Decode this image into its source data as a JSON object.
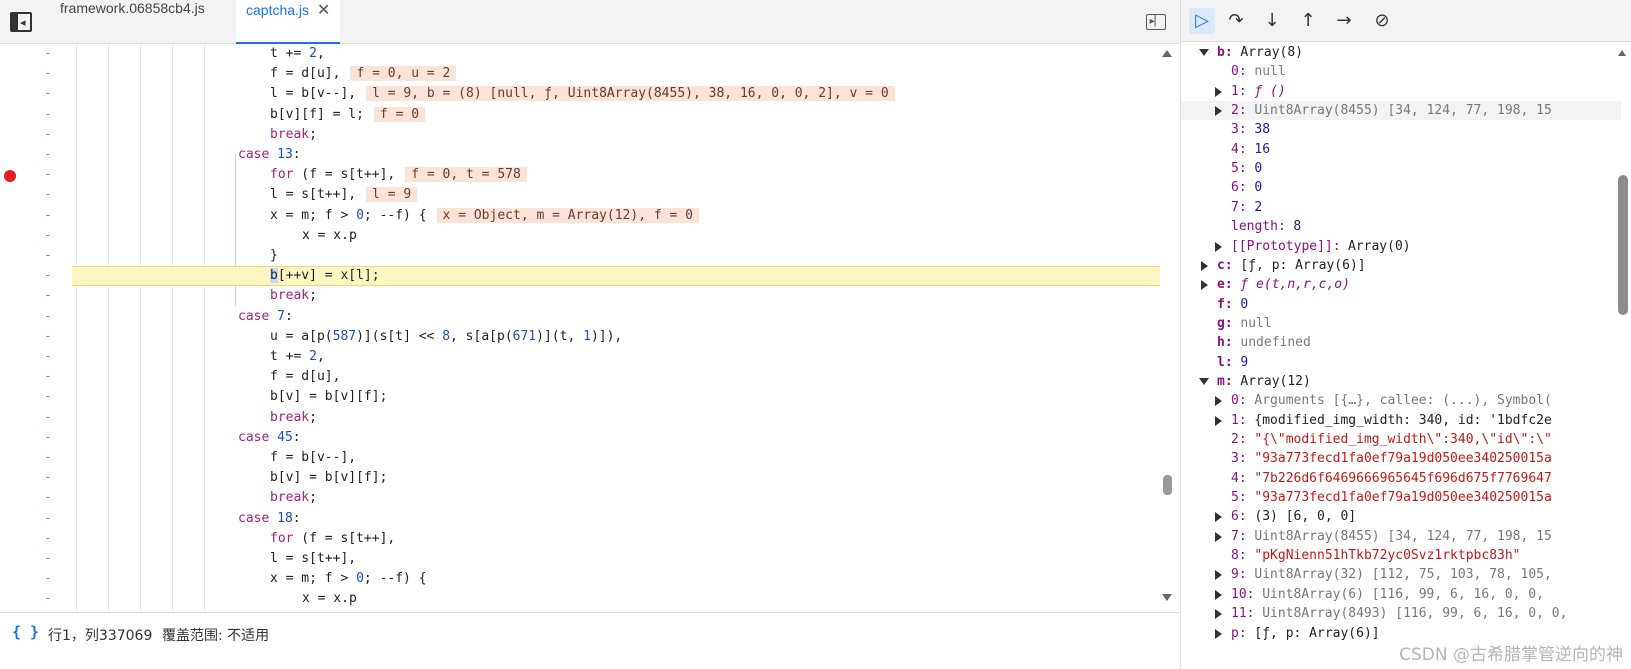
{
  "tabs": [
    {
      "label": "framework.06858cb4.js",
      "active": false
    },
    {
      "label": "captcha.js",
      "active": true
    }
  ],
  "code_lines": [
    {
      "text": "t += 2,",
      "indent": 2
    },
    {
      "text": "f = d[u],",
      "indent": 2,
      "inline": "f = 0, u = 2"
    },
    {
      "text": "l = b[v--],",
      "indent": 2,
      "inline": "l = 9, b = (8) [null, ƒ, Uint8Array(8455), 38, 16, 0, 0, 2], v = 0"
    },
    {
      "text": "b[v][f] = l;",
      "indent": 2,
      "inline": "f = 0"
    },
    {
      "text": "break;",
      "indent": 2,
      "kw": true
    },
    {
      "text": "case 13:",
      "indent": 1,
      "case": true
    },
    {
      "text": "for (f = s[t++],",
      "indent": 2,
      "inline": "f = 0, t = 578",
      "breakpoint": true
    },
    {
      "text": "l = s[t++],",
      "indent": 2,
      "inline": "l = 9"
    },
    {
      "text": "x = m; f > 0; --f) {",
      "indent": 2,
      "inline": "x = Object, m = Array(12), f = 0"
    },
    {
      "text": "x = x.p",
      "indent": 3
    },
    {
      "text": "}",
      "indent": 2
    },
    {
      "text": "b[++v] = x[l];",
      "indent": 2,
      "current": true
    },
    {
      "text": "break;",
      "indent": 2,
      "kw": true
    },
    {
      "text": "case 7:",
      "indent": 1,
      "case": true
    },
    {
      "text": "u = a[p(587)](s[t] << 8, s[a[p(671)](t, 1)]),",
      "indent": 2
    },
    {
      "text": "t += 2,",
      "indent": 2
    },
    {
      "text": "f = d[u],",
      "indent": 2
    },
    {
      "text": "b[v] = b[v][f];",
      "indent": 2
    },
    {
      "text": "break;",
      "indent": 2,
      "kw": true
    },
    {
      "text": "case 45:",
      "indent": 1,
      "case": true
    },
    {
      "text": "f = b[v--],",
      "indent": 2
    },
    {
      "text": "b[v] = b[v][f];",
      "indent": 2
    },
    {
      "text": "break;",
      "indent": 2,
      "kw": true
    },
    {
      "text": "case 18:",
      "indent": 1,
      "case": true
    },
    {
      "text": "for (f = s[t++],",
      "indent": 2
    },
    {
      "text": "l = s[t++],",
      "indent": 2
    },
    {
      "text": "x = m; f > 0; --f) {",
      "indent": 2
    },
    {
      "text": "x = x.p",
      "indent": 3
    }
  ],
  "gutter_marker": "-",
  "status": {
    "braces": "{ }",
    "position": "行1，列337069",
    "coverage": "覆盖范围: 不适用"
  },
  "debug_buttons": [
    "resume",
    "step-over",
    "step-into",
    "step-out",
    "step",
    "deactivate-breakpoints"
  ],
  "scope": [
    {
      "level": 0,
      "expand": "down",
      "key": "b",
      "value": "Array(8)",
      "vclass": "obj",
      "bold": true
    },
    {
      "level": 1,
      "key": "0",
      "value": "null",
      "vclass": "null"
    },
    {
      "level": 1,
      "expand": "right",
      "key": "1",
      "value": "ƒ ()",
      "vclass": "fn"
    },
    {
      "level": 1,
      "expand": "right",
      "key": "2",
      "value": "Uint8Array(8455) [34, 124, 77, 198, 15",
      "vclass": "dim",
      "hover": true
    },
    {
      "level": 1,
      "key": "3",
      "value": "38",
      "vclass": "num"
    },
    {
      "level": 1,
      "key": "4",
      "value": "16",
      "vclass": "num"
    },
    {
      "level": 1,
      "key": "5",
      "value": "0",
      "vclass": "num"
    },
    {
      "level": 1,
      "key": "6",
      "value": "0",
      "vclass": "num"
    },
    {
      "level": 1,
      "key": "7",
      "value": "2",
      "vclass": "num"
    },
    {
      "level": 1,
      "key": "length",
      "value": "8",
      "vclass": "num"
    },
    {
      "level": 1,
      "expand": "right",
      "key": "[[Prototype]]",
      "value": "Array(0)",
      "vclass": "obj"
    },
    {
      "level": 0,
      "expand": "right",
      "key": "c",
      "value": "[ƒ, p: Array(6)]",
      "vclass": "obj",
      "bold": true
    },
    {
      "level": 0,
      "expand": "right",
      "key": "e",
      "value": "ƒ e(t,n,r,c,o)",
      "vclass": "fn",
      "bold": true
    },
    {
      "level": 0,
      "key": "f",
      "value": "0",
      "vclass": "num",
      "bold": true
    },
    {
      "level": 0,
      "key": "g",
      "value": "null",
      "vclass": "null",
      "bold": true
    },
    {
      "level": 0,
      "key": "h",
      "value": "undefined",
      "vclass": "null",
      "bold": true
    },
    {
      "level": 0,
      "key": "l",
      "value": "9",
      "vclass": "num",
      "bold": true
    },
    {
      "level": 0,
      "expand": "down",
      "key": "m",
      "value": "Array(12)",
      "vclass": "obj",
      "bold": true
    },
    {
      "level": 1,
      "expand": "right",
      "key": "0",
      "value": "Arguments [{…}, callee: (...), Symbol(",
      "vclass": "dim"
    },
    {
      "level": 1,
      "expand": "right",
      "key": "1",
      "value": "{modified_img_width: 340, id: '1bdfc2e",
      "vclass": "obj"
    },
    {
      "level": 1,
      "key": "2",
      "value": "\"{\\\"modified_img_width\\\":340,\\\"id\\\":\\\"",
      "vclass": "str"
    },
    {
      "level": 1,
      "key": "3",
      "value": "\"93a773fecd1fa0ef79a19d050ee340250015a",
      "vclass": "str"
    },
    {
      "level": 1,
      "key": "4",
      "value": "\"7b226d6f6469666965645f696d675f7769647",
      "vclass": "str"
    },
    {
      "level": 1,
      "key": "5",
      "value": "\"93a773fecd1fa0ef79a19d050ee340250015a",
      "vclass": "str"
    },
    {
      "level": 1,
      "expand": "right",
      "key": "6",
      "value": "(3) [6, 0, 0]",
      "vclass": "obj"
    },
    {
      "level": 1,
      "expand": "right",
      "key": "7",
      "value": "Uint8Array(8455) [34, 124, 77, 198, 15",
      "vclass": "dim"
    },
    {
      "level": 1,
      "key": "8",
      "value": "\"pKgNienn51hTkb72yc0Svz1rktpbc83h\"",
      "vclass": "str"
    },
    {
      "level": 1,
      "expand": "right",
      "key": "9",
      "value": "Uint8Array(32) [112, 75, 103, 78, 105,",
      "vclass": "dim"
    },
    {
      "level": 1,
      "expand": "right",
      "key": "10",
      "value": "Uint8Array(6) [116, 99, 6, 16, 0, 0,",
      "vclass": "dim"
    },
    {
      "level": 1,
      "expand": "right",
      "key": "11",
      "value": "Uint8Array(8493) [116, 99, 6, 16, 0, 0,",
      "vclass": "dim"
    },
    {
      "level": 1,
      "expand": "right",
      "key": "p",
      "value": "[ƒ, p: Array(6)]",
      "vclass": "obj"
    }
  ],
  "watermark": "CSDN @古希腊掌管逆向的神"
}
